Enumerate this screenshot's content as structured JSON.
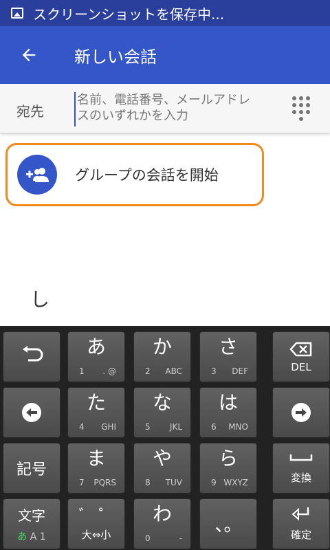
{
  "status_bar": {
    "text": "スクリーンショットを保存中..."
  },
  "app_bar": {
    "title": "新しい会話"
  },
  "recipient": {
    "label": "宛先",
    "placeholder_line1": "名前、電話番号、メールアドレ",
    "placeholder_line2": "スのいずれかを入力"
  },
  "group": {
    "label": "グループの会話を開始"
  },
  "compose": {
    "preview": "し"
  },
  "keyboard": {
    "keys": {
      "a": {
        "main": "あ",
        "num": "1",
        "sub": ". @"
      },
      "ka": {
        "main": "か",
        "num": "2",
        "sub": "ABC"
      },
      "sa": {
        "main": "さ",
        "num": "3",
        "sub": "DEF"
      },
      "ta": {
        "main": "た",
        "num": "4",
        "sub": "GHI"
      },
      "na": {
        "main": "な",
        "num": "5",
        "sub": "JKL"
      },
      "ha": {
        "main": "は",
        "num": "6",
        "sub": "MNO"
      },
      "ma": {
        "main": "ま",
        "num": "7",
        "sub": "PQRS"
      },
      "ya": {
        "main": "や",
        "num": "8",
        "sub": "TUV"
      },
      "ra": {
        "main": "ら",
        "num": "9",
        "sub": "WXYZ"
      },
      "wa": {
        "main": "わ",
        "num": "0",
        "sub": "-"
      }
    },
    "del_label": "DEL",
    "symbol_label": "記号",
    "convert_label": "変換",
    "mode_label": "文字",
    "mode_kana": "あ",
    "mode_rest": "A 1",
    "dakuten_label": "゛ ゜",
    "size_label": "大⇔小",
    "punct_label": "、。",
    "enter_label": "確定"
  },
  "colors": {
    "status_bar": "#2a3f9c",
    "app_bar": "#3556c8",
    "highlight": "#f08a1c",
    "kana_indicator": "#4cd964"
  }
}
